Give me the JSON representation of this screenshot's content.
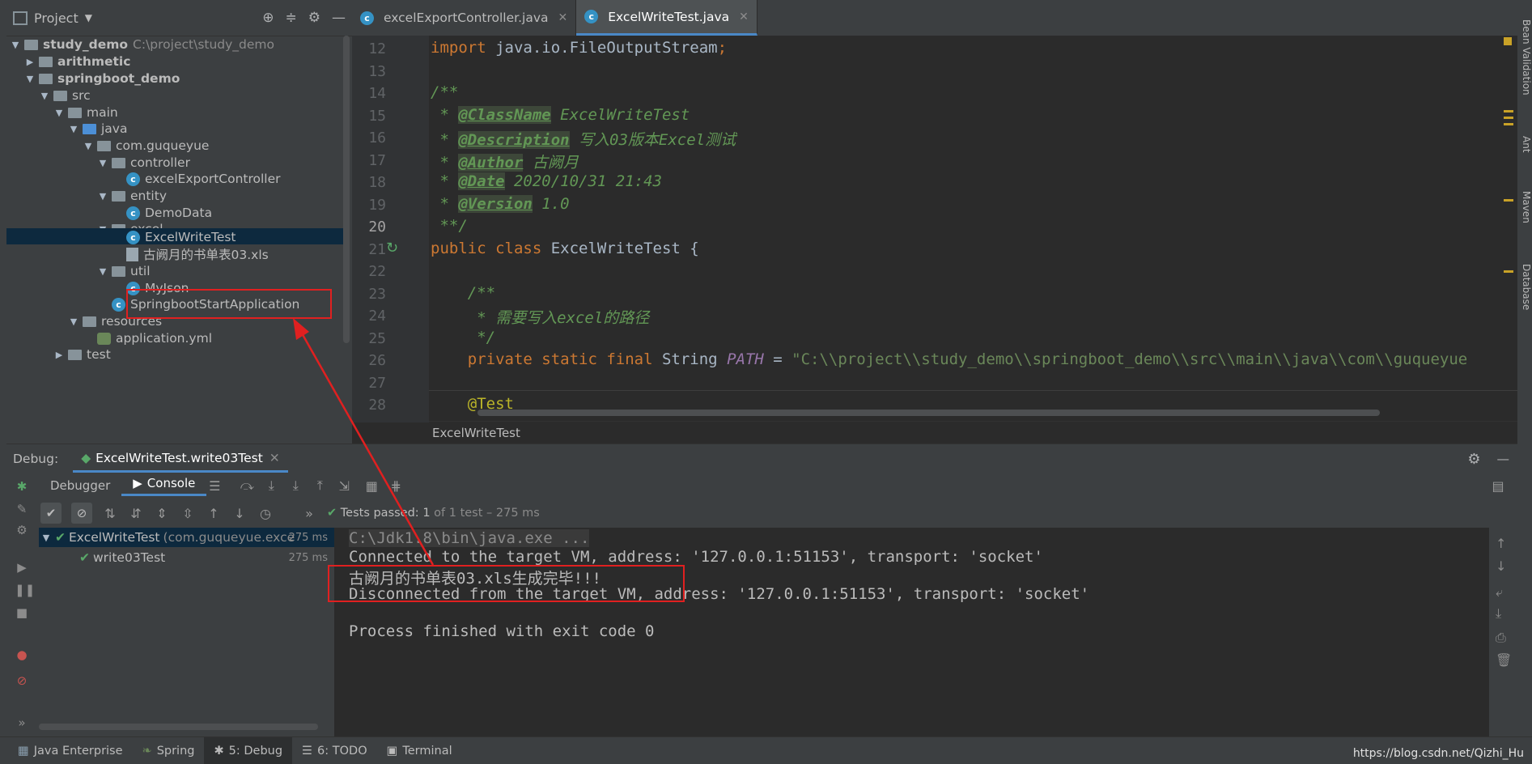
{
  "project_panel": {
    "title": "Project",
    "tree": [
      {
        "label": "study_demo",
        "path": "C:\\project\\study_demo"
      },
      {
        "label": "arithmetic"
      },
      {
        "label": "springboot_demo"
      },
      {
        "label": "src"
      },
      {
        "label": "main"
      },
      {
        "label": "java"
      },
      {
        "label": "com.guqueyue"
      },
      {
        "label": "controller"
      },
      {
        "label": "excelExportController"
      },
      {
        "label": "entity"
      },
      {
        "label": "DemoData"
      },
      {
        "label": "excel"
      },
      {
        "label": "ExcelWriteTest"
      },
      {
        "label": "古阙月的书单表03.xls"
      },
      {
        "label": "util"
      },
      {
        "label": "MyJson"
      },
      {
        "label": "SpringbootStartApplication"
      },
      {
        "label": "resources"
      },
      {
        "label": "application.yml"
      },
      {
        "label": "test"
      }
    ]
  },
  "editor": {
    "tabs": [
      {
        "label": "excelExportController.java"
      },
      {
        "label": "ExcelWriteTest.java"
      }
    ],
    "lines": [
      {
        "num": "12",
        "text": "import java.io.FileOutputStream;"
      },
      {
        "num": "13",
        "text": ""
      },
      {
        "num": "14",
        "text": "/**"
      },
      {
        "num": "15",
        "tag": "@ClassName",
        "text": " ExcelWriteTest"
      },
      {
        "num": "16",
        "tag": "@Description",
        "text": " 写入03版本Excel测试"
      },
      {
        "num": "17",
        "tag": "@Author",
        "text": " 古阙月"
      },
      {
        "num": "18",
        "tag": "@Date",
        "text": " 2020/10/31 21:43"
      },
      {
        "num": "19",
        "tag": "@Version",
        "text": " 1.0"
      },
      {
        "num": "20",
        "text": " **/"
      },
      {
        "num": "21",
        "text": "public class ExcelWriteTest {"
      },
      {
        "num": "22",
        "text": ""
      },
      {
        "num": "23",
        "text": "    /**"
      },
      {
        "num": "24",
        "text": "     * 需要写入excel的路径"
      },
      {
        "num": "25",
        "text": "     */"
      },
      {
        "num": "26",
        "text": "    private static final String PATH = \"C:\\\\project\\\\study_demo\\\\springboot_demo\\\\src\\\\main\\\\java\\\\com\\\\guqueyue"
      },
      {
        "num": "27",
        "text": ""
      },
      {
        "num": "28",
        "text": "    @Test"
      }
    ],
    "breadcrumb": "ExcelWriteTest"
  },
  "right_tools": [
    "Bean Validation",
    "Ant",
    "Maven",
    "Database"
  ],
  "debug": {
    "label": "Debug:",
    "session_tab": "ExcelWriteTest.write03Test",
    "tabs": [
      "Debugger",
      "Console"
    ],
    "status": {
      "prefix": "Tests passed:",
      "count": "1",
      "suffix": "of 1 test – 275 ms"
    },
    "tests": [
      {
        "name": "ExcelWriteTest",
        "pkg": "(com.guqueyue.exce",
        "time": "275 ms"
      },
      {
        "name": "write03Test",
        "time": "275 ms"
      }
    ],
    "console": [
      "C:\\Jdk1.8\\bin\\java.exe ...",
      "Connected to the target VM, address: '127.0.0.1:51153', transport: 'socket'",
      "古阙月的书单表03.xls生成完毕!!!",
      "Disconnected from the target VM, address: '127.0.0.1:51153', transport: 'socket'",
      "",
      "Process finished with exit code 0"
    ]
  },
  "bottom_bar": {
    "items": [
      {
        "label": "Java Enterprise"
      },
      {
        "label": "Spring"
      },
      {
        "label": "5: Debug"
      },
      {
        "label": "6: TODO"
      },
      {
        "label": "Terminal"
      }
    ],
    "watermark": "https://blog.csdn.net/Qizhi_Hu"
  },
  "colors": {
    "accent": "#4a88c7",
    "annotation": "#e02020",
    "pass": "#59a869"
  }
}
